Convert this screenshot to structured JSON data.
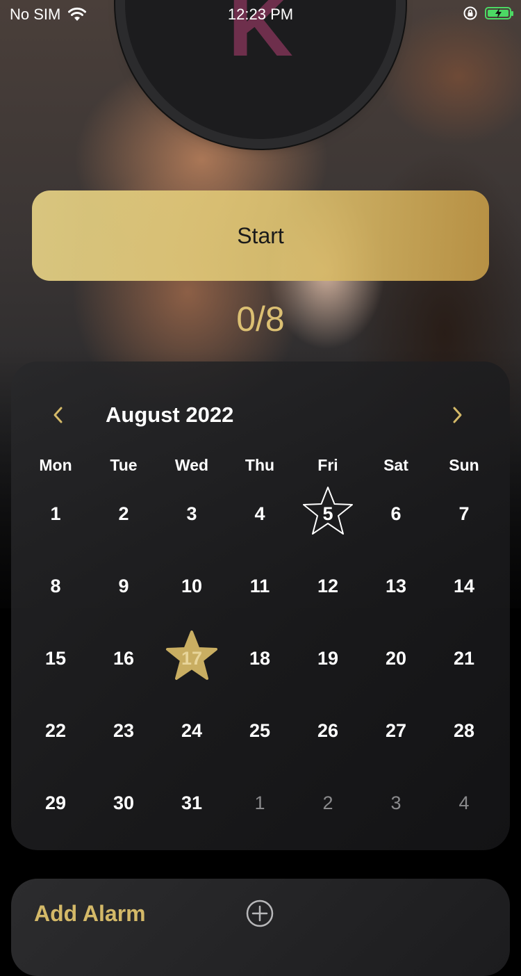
{
  "status_bar": {
    "carrier": "No SIM",
    "time": "12:23 PM"
  },
  "logo": {
    "letter": "K"
  },
  "start_button": {
    "label": "Start"
  },
  "progress": {
    "text": "0/8"
  },
  "calendar": {
    "month_label": "August 2022",
    "weekdays": [
      "Mon",
      "Tue",
      "Wed",
      "Thu",
      "Fri",
      "Sat",
      "Sun"
    ],
    "days": [
      {
        "label": "1",
        "in_month": true
      },
      {
        "label": "2",
        "in_month": true
      },
      {
        "label": "3",
        "in_month": true
      },
      {
        "label": "4",
        "in_month": true
      },
      {
        "label": "5",
        "in_month": true,
        "marker": "star-outline"
      },
      {
        "label": "6",
        "in_month": true
      },
      {
        "label": "7",
        "in_month": true
      },
      {
        "label": "8",
        "in_month": true
      },
      {
        "label": "9",
        "in_month": true
      },
      {
        "label": "10",
        "in_month": true
      },
      {
        "label": "11",
        "in_month": true
      },
      {
        "label": "12",
        "in_month": true
      },
      {
        "label": "13",
        "in_month": true
      },
      {
        "label": "14",
        "in_month": true
      },
      {
        "label": "15",
        "in_month": true
      },
      {
        "label": "16",
        "in_month": true
      },
      {
        "label": "17",
        "in_month": true,
        "marker": "star-filled"
      },
      {
        "label": "18",
        "in_month": true
      },
      {
        "label": "19",
        "in_month": true
      },
      {
        "label": "20",
        "in_month": true
      },
      {
        "label": "21",
        "in_month": true
      },
      {
        "label": "22",
        "in_month": true
      },
      {
        "label": "23",
        "in_month": true
      },
      {
        "label": "24",
        "in_month": true
      },
      {
        "label": "25",
        "in_month": true
      },
      {
        "label": "26",
        "in_month": true
      },
      {
        "label": "27",
        "in_month": true
      },
      {
        "label": "28",
        "in_month": true
      },
      {
        "label": "29",
        "in_month": true
      },
      {
        "label": "30",
        "in_month": true
      },
      {
        "label": "31",
        "in_month": true
      },
      {
        "label": "1",
        "in_month": false
      },
      {
        "label": "2",
        "in_month": false
      },
      {
        "label": "3",
        "in_month": false
      },
      {
        "label": "4",
        "in_month": false
      }
    ]
  },
  "alarm": {
    "label": "Add Alarm"
  },
  "colors": {
    "accent_gold": "#d4b968",
    "star_gold": "#c9ae62",
    "logo_letter": "#6e2f4c",
    "battery_green": "#4cd964"
  },
  "icons": {
    "prev": "chevron-left-icon",
    "next": "chevron-right-icon",
    "add": "plus-circle-icon",
    "wifi": "wifi-icon",
    "lock": "orientation-lock-icon",
    "battery": "battery-charging-icon"
  }
}
